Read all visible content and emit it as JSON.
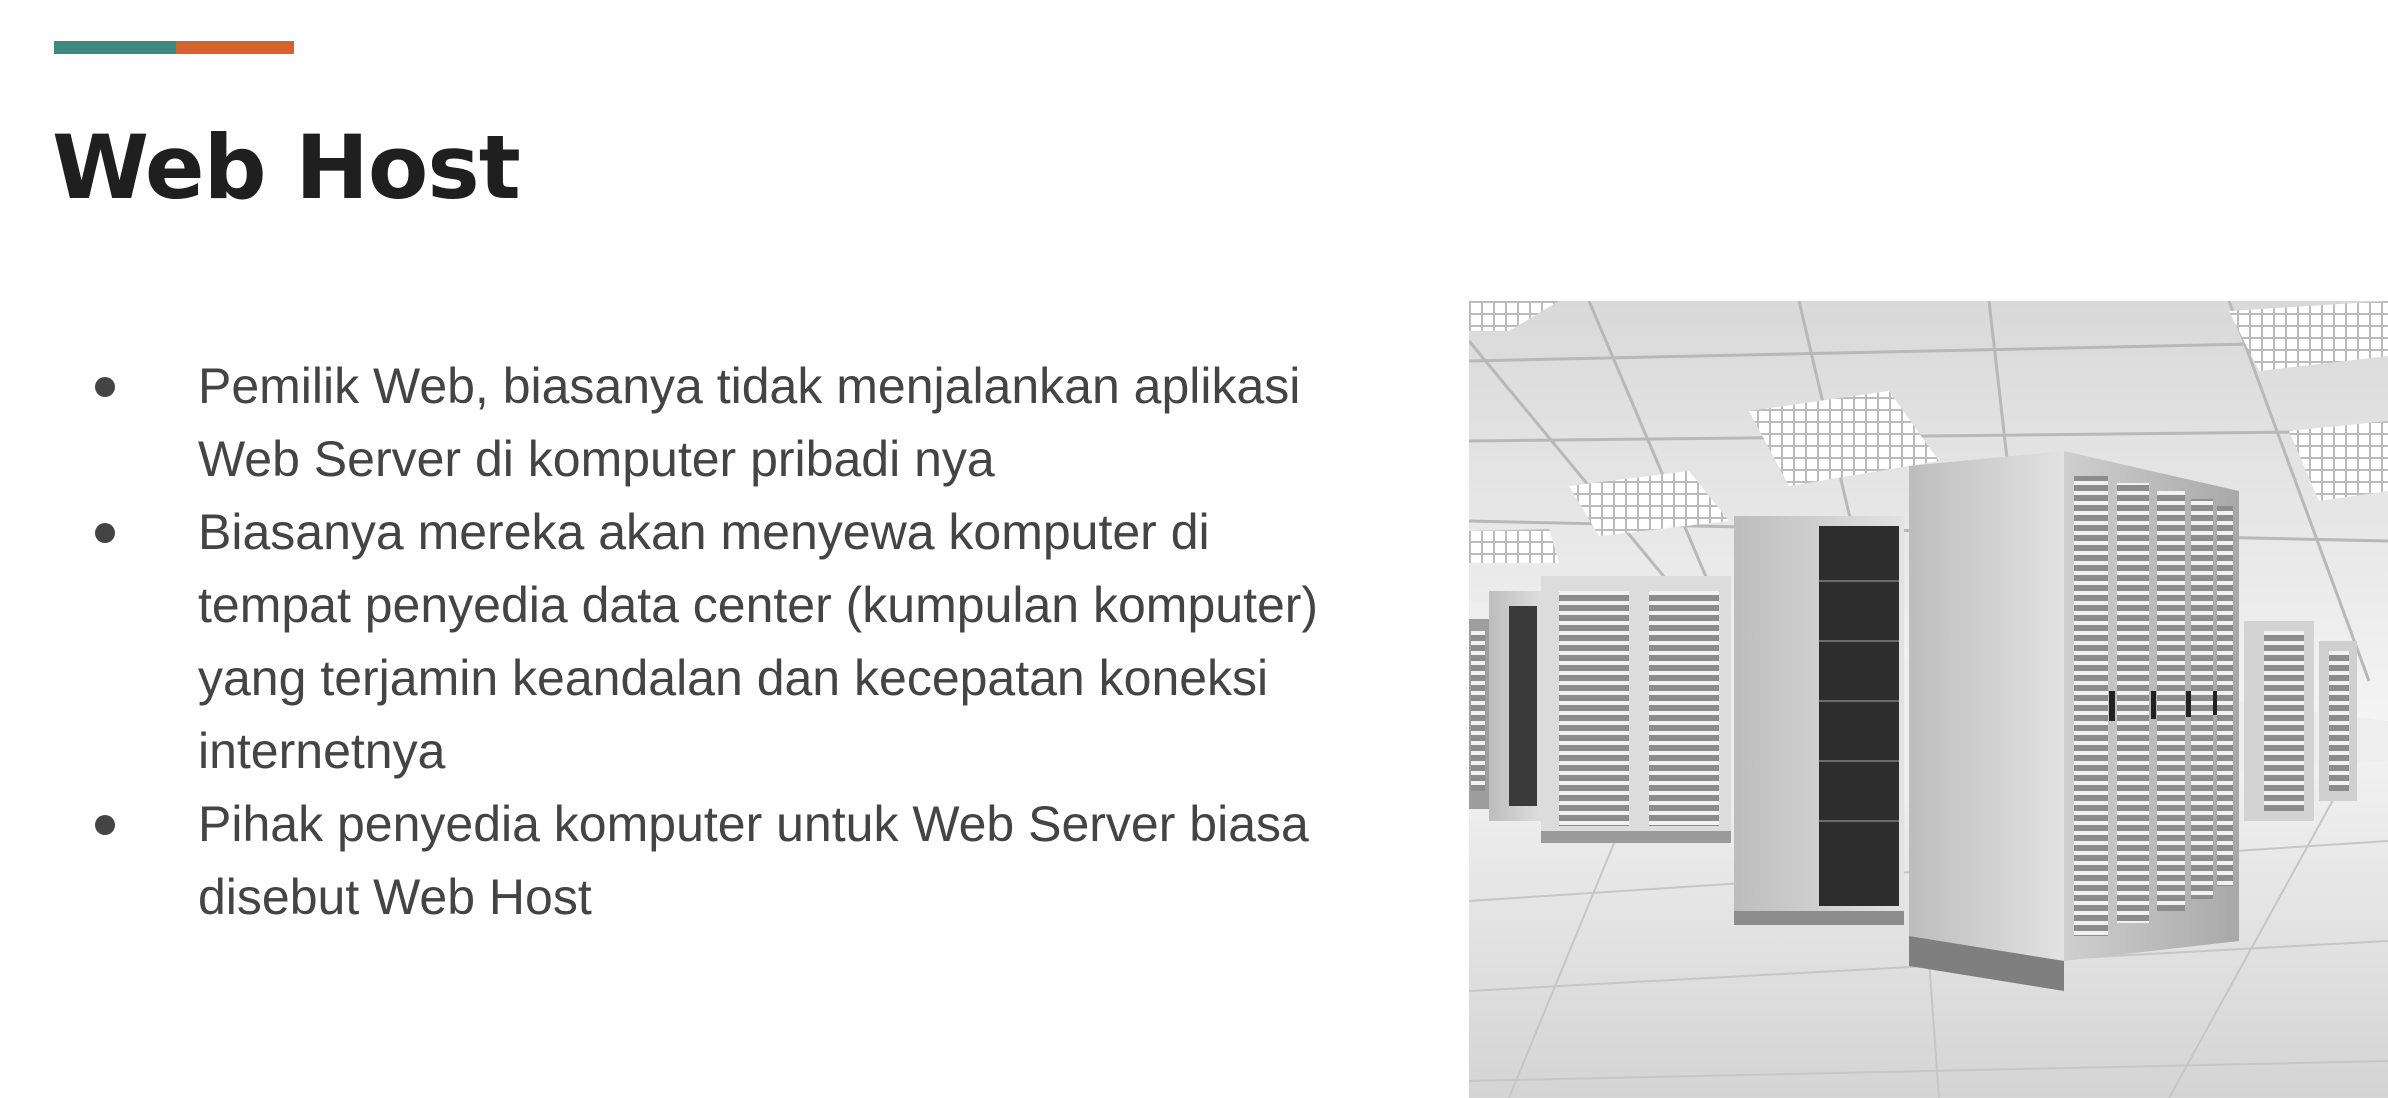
{
  "slide": {
    "title": "Web Host",
    "accent_colors": {
      "primary": "#3d8a7c",
      "secondary": "#d9602f"
    },
    "bullets": [
      {
        "lines": [
          "Pemilik Web, biasanya tidak menjalankan aplikasi",
          "Web Server di komputer pribadi nya"
        ]
      },
      {
        "lines": [
          "Biasanya mereka akan menyewa komputer di",
          "tempat penyedia data center (kumpulan komputer)",
          "yang terjamin keandalan dan kecepatan koneksi",
          "internetnya"
        ]
      },
      {
        "lines": [
          "Pihak penyedia komputer untuk Web Server biasa",
          "disebut Web Host"
        ]
      }
    ],
    "image": {
      "subject": "data-center-server-racks",
      "tone": "grayscale"
    }
  }
}
